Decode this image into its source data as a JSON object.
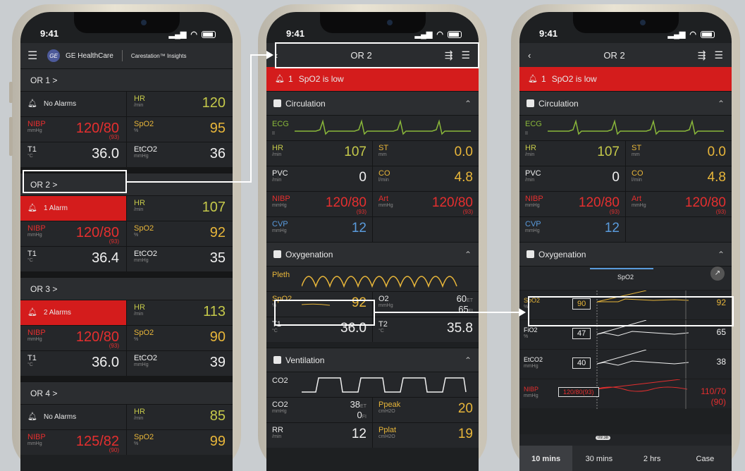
{
  "status_time": "9:41",
  "phone1": {
    "brand": "GE HealthCare",
    "product": "Carestation™ Insights",
    "rooms": [
      {
        "header": "OR 1 >",
        "alarm": "No Alarms",
        "alarm_red": false,
        "hr_label": "HR",
        "hr_unit": "/min",
        "hr": "120",
        "nibp_label": "NIBP",
        "nibp_unit": "mmHg",
        "nibp": "120/80",
        "nibp_sub": "(93)",
        "spo2_label": "SpO2",
        "spo2_unit": "%",
        "spo2": "95",
        "t1_label": "T1",
        "t1_unit": "°C",
        "t1": "36.0",
        "etco2_label": "EtCO2",
        "etco2_unit": "mmHg",
        "etco2": "36"
      },
      {
        "header": "OR 2 >",
        "alarm": "1 Alarm",
        "alarm_red": true,
        "hr_label": "HR",
        "hr_unit": "/min",
        "hr": "107",
        "nibp_label": "NIBP",
        "nibp_unit": "mmHg",
        "nibp": "120/80",
        "nibp_sub": "(93)",
        "spo2_label": "SpO2",
        "spo2_unit": "%",
        "spo2": "92",
        "t1_label": "T1",
        "t1_unit": "°C",
        "t1": "36.4",
        "etco2_label": "EtCO2",
        "etco2_unit": "mmHg",
        "etco2": "35"
      },
      {
        "header": "OR 3 >",
        "alarm": "2 Alarms",
        "alarm_red": true,
        "hr_label": "HR",
        "hr_unit": "/min",
        "hr": "113",
        "nibp_label": "NIBP",
        "nibp_unit": "mmHg",
        "nibp": "120/80",
        "nibp_sub": "(93)",
        "spo2_label": "SpO2",
        "spo2_unit": "%",
        "spo2": "90",
        "t1_label": "T1",
        "t1_unit": "°C",
        "t1": "36.0",
        "etco2_label": "EtCO2",
        "etco2_unit": "mmHg",
        "etco2": "39"
      },
      {
        "header": "OR 4 >",
        "alarm": "No Alarms",
        "alarm_red": false,
        "hr_label": "HR",
        "hr_unit": "/min",
        "hr": "85",
        "nibp_label": "NIBP",
        "nibp_unit": "mmHg",
        "nibp": "125/82",
        "nibp_sub": "(90)",
        "spo2_label": "SpO2",
        "spo2_unit": "%",
        "spo2": "99"
      }
    ]
  },
  "phone2": {
    "title": "OR 2",
    "alert_count": "1",
    "alert_text": "SpO2 is low",
    "circulation": "Circulation",
    "ecg_label": "ECG",
    "ecg_sub": "II",
    "hr_label": "HR",
    "hr_unit": "/min",
    "hr": "107",
    "st_label": "ST",
    "st_unit": "mm",
    "st": "0.0",
    "pvc_label": "PVC",
    "pvc_unit": "/min",
    "pvc": "0",
    "co_label": "CO",
    "co_unit": "l/min",
    "co": "4.8",
    "nibp_label": "NIBP",
    "nibp_unit": "mmHg",
    "nibp": "120/80",
    "nibp_sub": "(93)",
    "art_label": "Art",
    "art_unit": "mmHg",
    "art": "120/80",
    "art_sub": "(93)",
    "cvp_label": "CVP",
    "cvp_unit": "mmHg",
    "cvp": "12",
    "oxygenation": "Oxygenation",
    "pleth_label": "Pleth",
    "spo2_label": "SpO2",
    "spo2_unit": "%",
    "spo2": "92",
    "o2_label": "O2",
    "o2_unit": "mmHg",
    "o2_et": "60",
    "o2_et_unit": "ET",
    "o2_fi": "65",
    "o2_fi_unit": "FI",
    "t1_label": "T1",
    "t1_unit": "°C",
    "t1": "36.0",
    "t2_label": "T2",
    "t2_unit": "°C",
    "t2": "35.8",
    "ventilation": "Ventilation",
    "co2_wave_label": "CO2",
    "co2_label": "CO2",
    "co2_unit": "mmHg",
    "co2_et": "38",
    "co2_et_unit": "ET",
    "co2_fi": "0",
    "co2_fi_unit": "FI",
    "ppeak_label": "Ppeak",
    "ppeak_unit": "cmH2O",
    "ppeak": "20",
    "rr_label": "RR",
    "rr_unit": "/min",
    "rr": "12",
    "pplat_label": "Pplat",
    "pplat_unit": "cmH2O",
    "pplat": "19"
  },
  "phone3": {
    "title": "OR 2",
    "alert_count": "1",
    "alert_text": "SpO2 is low",
    "circulation": "Circulation",
    "ecg_label": "ECG",
    "ecg_sub": "II",
    "hr_label": "HR",
    "hr_unit": "/min",
    "hr": "107",
    "st_label": "ST",
    "st_unit": "mm",
    "st": "0.0",
    "pvc_label": "PVC",
    "pvc_unit": "/min",
    "pvc": "0",
    "co_label": "CO",
    "co_unit": "l/min",
    "co": "4.8",
    "nibp_label": "NIBP",
    "nibp_unit": "mmHg",
    "nibp": "120/80",
    "nibp_sub": "(93)",
    "art_label": "Art",
    "art_unit": "mmHg",
    "art": "120/80",
    "art_sub": "(93)",
    "cvp_label": "CVP",
    "cvp_unit": "mmHg",
    "cvp": "12",
    "oxygenation": "Oxygenation",
    "trend_tab": "SpO2",
    "trends": [
      {
        "label": "SpO2",
        "unit": "%",
        "box": "90",
        "end": "92",
        "color": "#e8b63a"
      },
      {
        "label": "FiO2",
        "unit": "%",
        "box": "47",
        "end": "65",
        "color": "#f0f0f0"
      },
      {
        "label": "EtCO2",
        "unit": "mmHg",
        "box": "40",
        "end": "38",
        "color": "#f0f0f0"
      },
      {
        "label": "NIBP",
        "unit": "mmHg",
        "box": "120/80(93)",
        "end": "110/70",
        "end_sub": "(90)",
        "color": "#e52f2f"
      }
    ],
    "time_marker": "09:38",
    "tabs": [
      "10 mins",
      "30 mins",
      "2 hrs",
      "Case"
    ],
    "active_tab": "10 mins"
  }
}
